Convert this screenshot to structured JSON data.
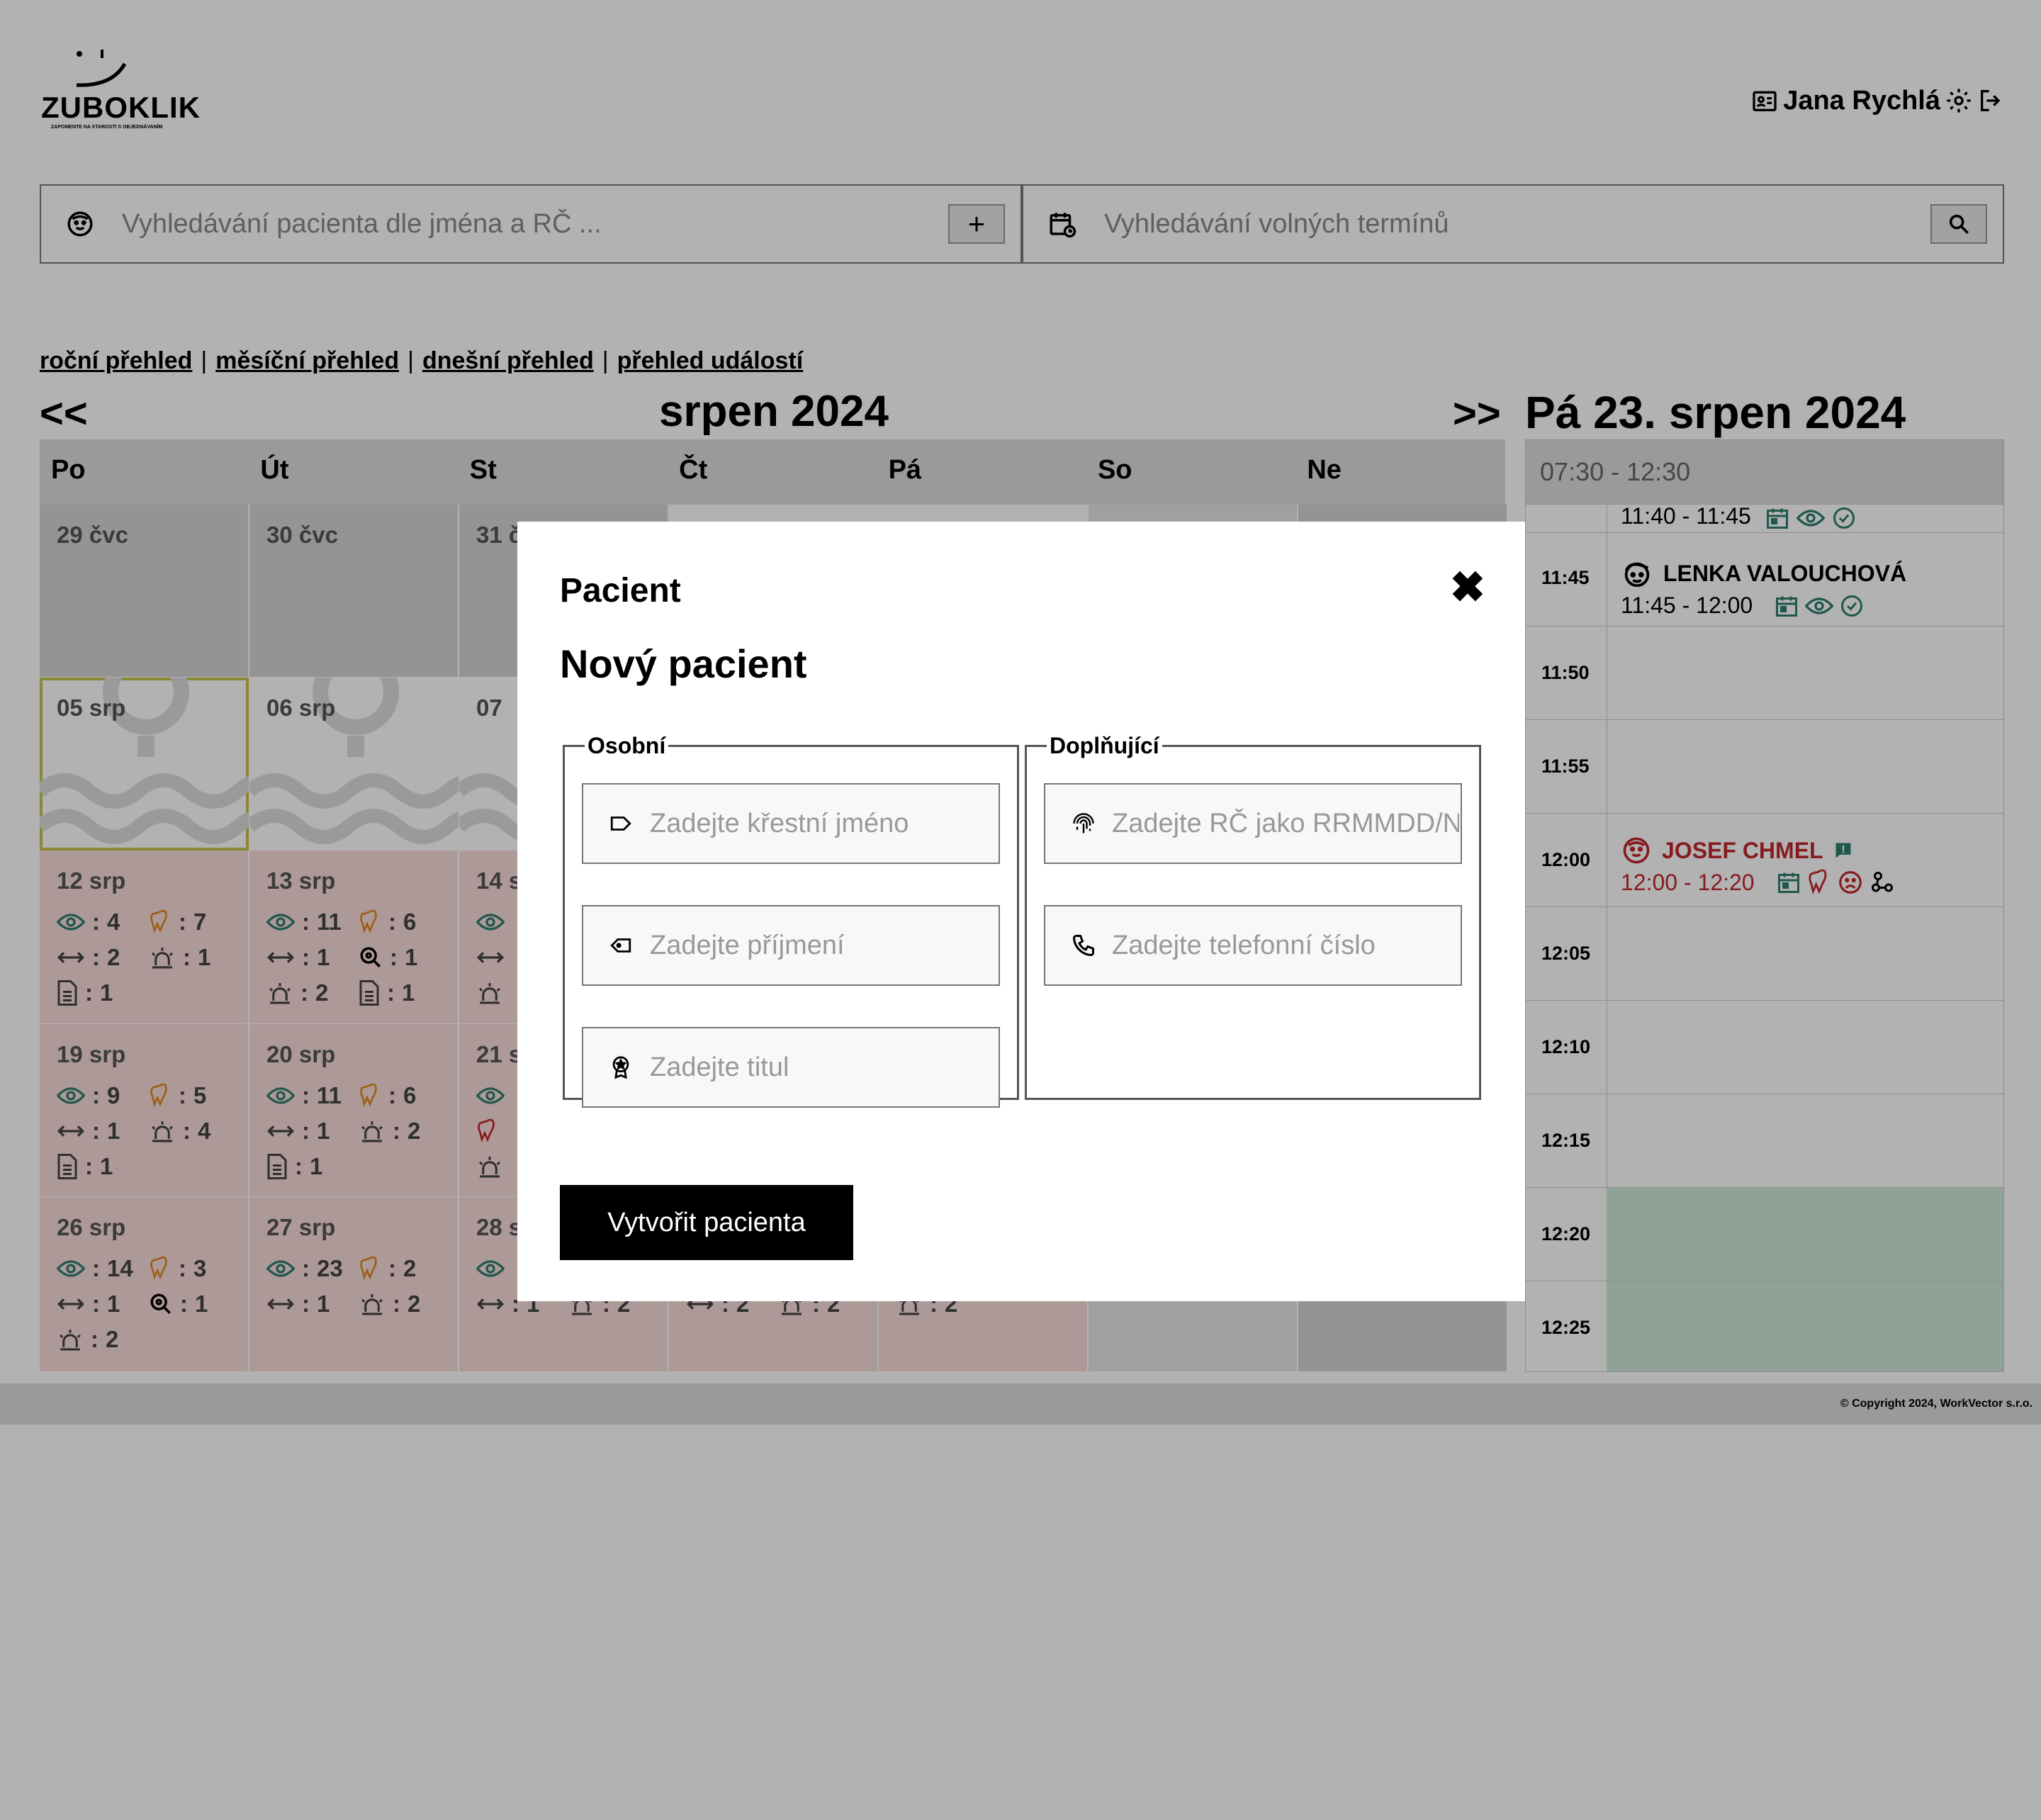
{
  "header": {
    "logo_text": "ZUBOKLIK",
    "logo_tagline": "ZAPOMENTE NA STAROSTI S OBJEDNÁVANÍM",
    "user_name": "Jana Rychlá"
  },
  "search": {
    "patient_placeholder": "Vyhledávání pacienta dle jména a RČ ...",
    "add_label": "+",
    "term_placeholder": "Vyhledávání volných termínů"
  },
  "nav": {
    "links": [
      "roční přehled",
      "měsíční přehled",
      "dnešní přehled",
      "přehled událostí"
    ],
    "separator": "|"
  },
  "calendar": {
    "prev": "<<",
    "next": ">>",
    "month_title": "srpen 2024",
    "weekdays": [
      "Po",
      "Út",
      "St",
      "Čt",
      "Pá",
      "So",
      "Ne"
    ],
    "cells": {
      "d29": "29 čvc",
      "d30": "30 čvc",
      "d31": "31 č",
      "d05": "05 srp",
      "d06": "06 srp",
      "d07": "07",
      "d12": "12 srp",
      "d13": "13 srp",
      "d14": "14 s",
      "d19": "19 srp",
      "d20": "20 srp",
      "d21": "21 s",
      "d26": "26 srp",
      "d27": "27 srp",
      "d28": "28 s"
    },
    "stats": {
      "d12": {
        "eye": "4",
        "tooth": "7",
        "arrows": "2",
        "alarm": "1",
        "doc": "1"
      },
      "d13": {
        "eye": "11",
        "tooth": "6",
        "arrows": "1",
        "search": "1",
        "alarm": "2",
        "doc": "1"
      },
      "d19": {
        "eye": "9",
        "tooth": "5",
        "arrows": "1",
        "alarm": "4",
        "doc": "1"
      },
      "d20": {
        "eye": "11",
        "tooth": "6",
        "arrows": "1",
        "alarm": "2",
        "doc": "1"
      },
      "d26": {
        "eye": "14",
        "tooth": "3",
        "arrows": "1",
        "search": "1",
        "alarm": "2"
      },
      "d27": {
        "eye": "23",
        "tooth": "2",
        "arrows": "1",
        "alarm": "2"
      },
      "d28": {
        "arrows": "1",
        "alarm": "2"
      },
      "d29b": {
        "arrows": "2",
        "alarm": "2"
      },
      "d30b": {
        "alarm": "2"
      }
    },
    "colon": ":"
  },
  "day": {
    "title": "Pá 23. srpen 2024",
    "range": "07:30 - 12:30",
    "slots": [
      "11:45",
      "11:50",
      "11:55",
      "12:00",
      "12:05",
      "12:10",
      "12:15",
      "12:20",
      "12:25"
    ],
    "appointments": [
      {
        "name": "",
        "time": "11:40 - 11:45"
      },
      {
        "name": "LENKA VALOUCHOVÁ",
        "time": "11:45 - 12:00"
      },
      {
        "name": "JOSEF CHMEL",
        "time": "12:00 - 12:20"
      }
    ]
  },
  "footer": {
    "copyright": "© Copyright 2024, WorkVector s.r.o."
  },
  "modal": {
    "title": "Pacient",
    "close": "✖",
    "subtitle": "Nový pacient",
    "personal_legend": "Osobní",
    "extra_legend": "Doplňující",
    "first_name_placeholder": "Zadejte křestní jméno",
    "last_name_placeholder": "Zadejte příjmení",
    "title_placeholder": "Zadejte titul",
    "rc_placeholder": "Zadejte RČ jako RRMMDD/NNNN",
    "phone_placeholder": "Zadejte telefonní číslo",
    "submit": "Vytvořit pacienta"
  },
  "colors": {
    "teal": "#2f7f6f",
    "orange": "#e08a1e",
    "red": "#c0272d",
    "pink_cell": "#fadcdc",
    "green_slot": "#cfe8d6"
  }
}
